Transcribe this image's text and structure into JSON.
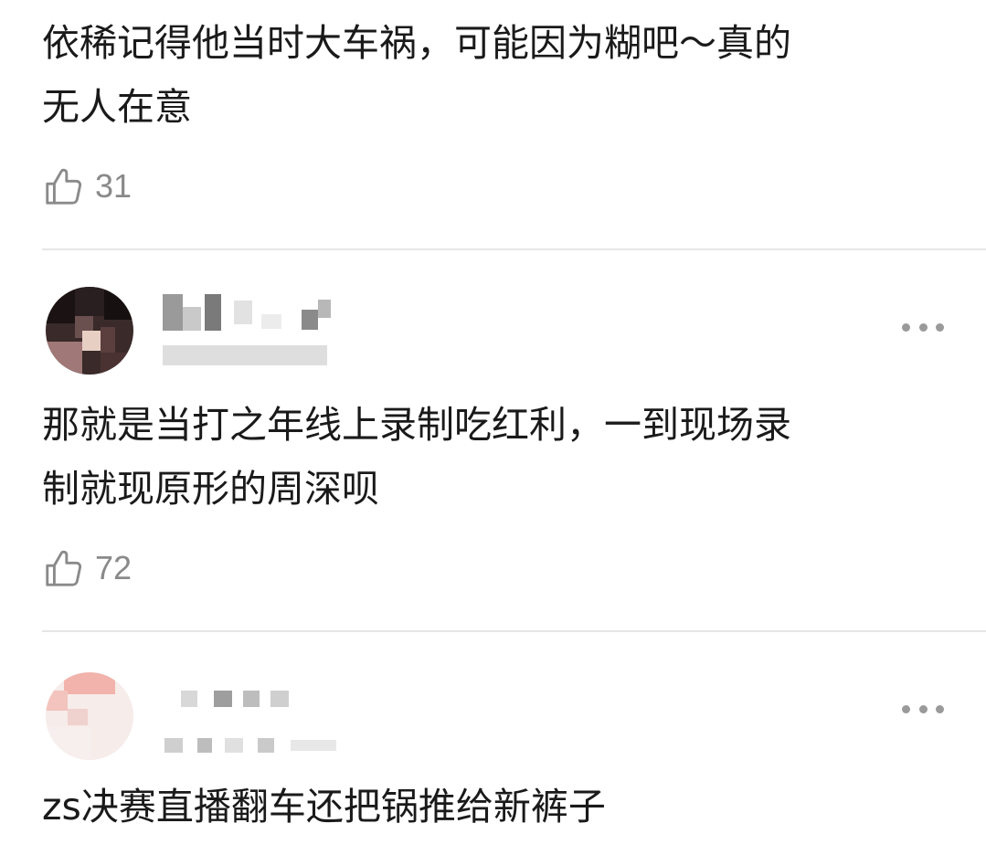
{
  "comments": [
    {
      "text_line1": "依稀记得他当时大车祸，可能因为糊吧～真的",
      "text_line2": "无人在意",
      "likes": "31"
    },
    {
      "text_line1": "那就是当打之年线上录制吃红利，一到现场录",
      "text_line2": "制就现原形的周深呗",
      "likes": "72"
    },
    {
      "text_line1": "zs决赛直播翻车还把锅推给新裤子"
    }
  ],
  "icons": {
    "like": "thumbs-up-icon",
    "more": "more-dots-icon"
  },
  "colors": {
    "text": "#1a1a1a",
    "meta": "#8a8a8a",
    "divider": "#e6e6e6"
  }
}
